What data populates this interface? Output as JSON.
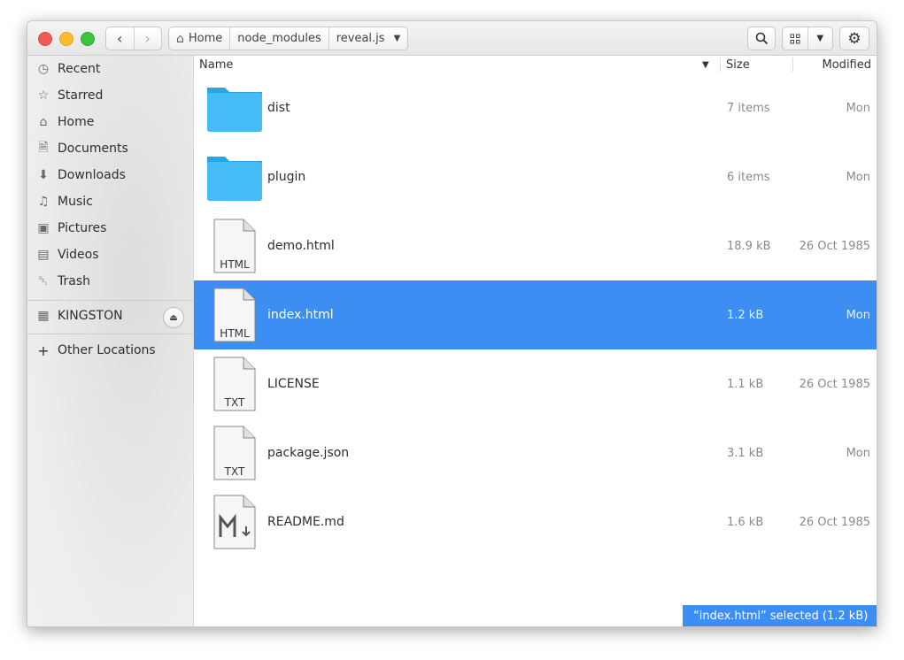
{
  "header": {
    "back_icon": "chevron-left-icon",
    "forward_icon": "chevron-right-icon",
    "breadcrumbs": [
      {
        "label": "Home",
        "icon": "home-icon"
      },
      {
        "label": "node_modules"
      },
      {
        "label": "reveal.js"
      }
    ]
  },
  "sidebar": {
    "items": [
      {
        "label": "Recent",
        "icon": "clock-icon"
      },
      {
        "label": "Starred",
        "icon": "star-icon"
      },
      {
        "label": "Home",
        "icon": "home-icon"
      },
      {
        "label": "Documents",
        "icon": "document-icon"
      },
      {
        "label": "Downloads",
        "icon": "download-icon"
      },
      {
        "label": "Music",
        "icon": "music-note-icon"
      },
      {
        "label": "Pictures",
        "icon": "camera-icon"
      },
      {
        "label": "Videos",
        "icon": "film-icon"
      },
      {
        "label": "Trash",
        "icon": "trash-icon"
      }
    ],
    "devices": [
      {
        "label": "KINGSTON",
        "icon": "drive-icon"
      }
    ],
    "other": {
      "label": "Other Locations",
      "icon": "plus-icon"
    }
  },
  "columns": {
    "name": "Name",
    "size": "Size",
    "modified": "Modified"
  },
  "files": [
    {
      "name": "dist",
      "size": "7 items",
      "modified": "Mon",
      "type": "folder"
    },
    {
      "name": "plugin",
      "size": "6 items",
      "modified": "Mon",
      "type": "folder"
    },
    {
      "name": "demo.html",
      "size": "18.9 kB",
      "modified": "26 Oct 1985",
      "type": "document",
      "label": "HTML"
    },
    {
      "name": "index.html",
      "size": "1.2 kB",
      "modified": "Mon",
      "type": "document",
      "label": "HTML",
      "selected": true
    },
    {
      "name": "LICENSE",
      "size": "1.1 kB",
      "modified": "26 Oct 1985",
      "type": "document",
      "label": "TXT"
    },
    {
      "name": "package.json",
      "size": "3.1 kB",
      "modified": "Mon",
      "type": "document",
      "label": "TXT"
    },
    {
      "name": "README.md",
      "size": "1.6 kB",
      "modified": "26 Oct 1985",
      "type": "markdown"
    }
  ],
  "status": {
    "text": "“index.html” selected (1.2 kB)"
  },
  "colors": {
    "selection": "#3d8ef2",
    "folder": "#3fb7f0",
    "close": "#f25a55",
    "minimize": "#f8bd2f",
    "maximize": "#3ec33e"
  }
}
